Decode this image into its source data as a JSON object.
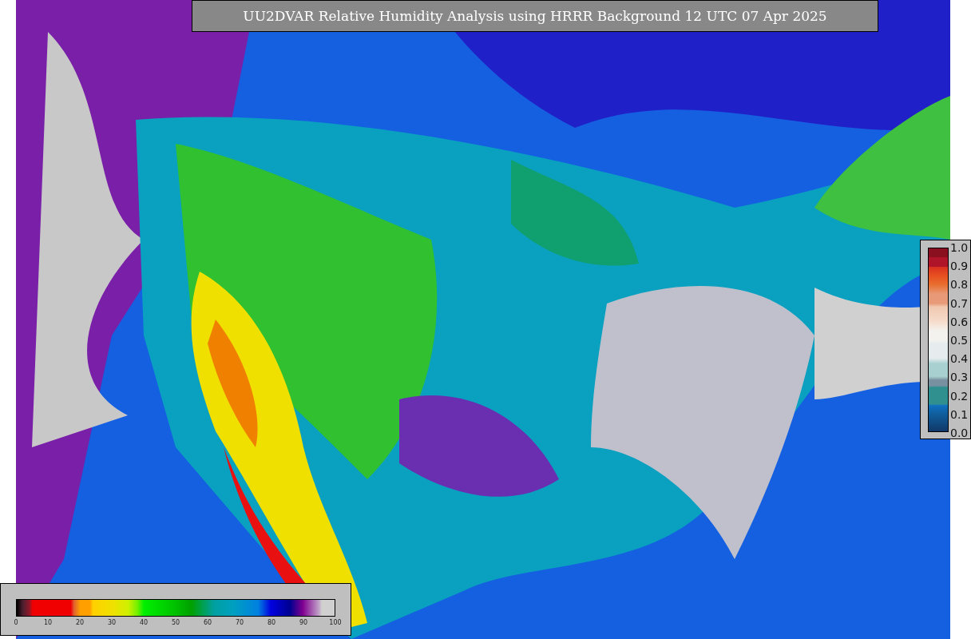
{
  "title": "UU2DVAR Relative Humidity Analysis using HRRR Background 12 UTC 07 Apr 2025",
  "fraction_legend": {
    "ticks": [
      "1.0",
      "0.9",
      "0.8",
      "0.7",
      "0.6",
      "0.5",
      "0.4",
      "0.3",
      "0.2",
      "0.1",
      "0.0"
    ]
  },
  "humidity_legend": {
    "ticks": [
      "0",
      "10",
      "20",
      "30",
      "40",
      "50",
      "60",
      "70",
      "80",
      "90",
      "100"
    ]
  }
}
